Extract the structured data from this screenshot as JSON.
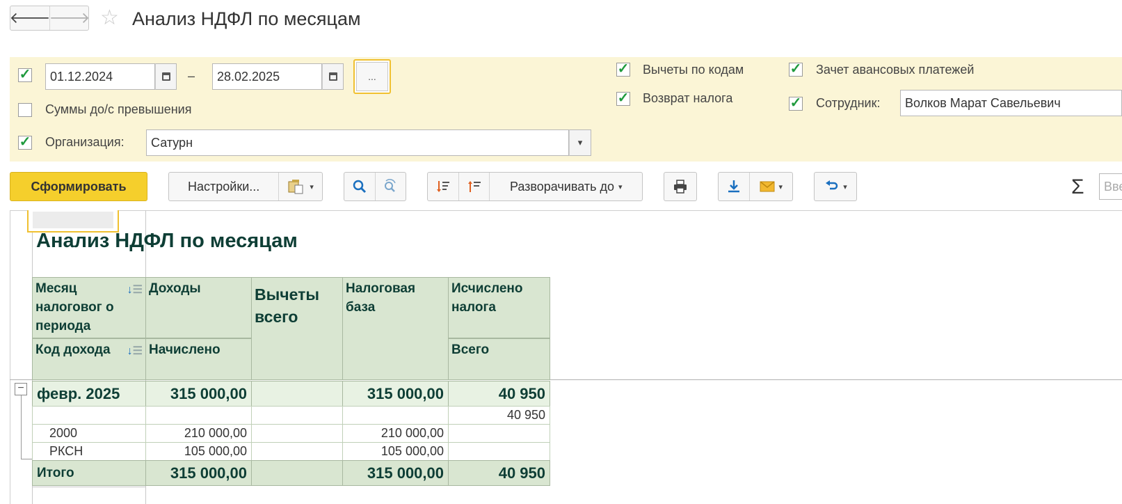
{
  "header": {
    "back_glyph": "🡐",
    "forward_glyph": "🡒",
    "star_glyph": "☆",
    "title": "Анализ НДФЛ по месяцам"
  },
  "filters": {
    "period_from": "01.12.2024",
    "period_dash": "–",
    "period_to": "28.02.2025",
    "dots_label": "...",
    "excess_label": "Суммы до/с превышения",
    "org_label": "Организация:",
    "org_value": "Сатурн",
    "deductions_codes_label": "Вычеты по кодам",
    "tax_return_label": "Возврат налога",
    "advance_label": "Зачет авансовых платежей",
    "employee_label": "Сотрудник:",
    "employee_value": "Волков Марат Савельевич",
    "dropdown_glyph": "▾"
  },
  "toolbar": {
    "generate": "Сформировать",
    "settings": "Настройки...",
    "expand_to": "Разворачивать до",
    "sigma": "Σ",
    "search_placeholder": "Вве"
  },
  "report": {
    "title": "Анализ НДФЛ по месяцам",
    "columns": {
      "month": "Месяц налоговог о периода",
      "income": "Доходы",
      "deductions": "Вычеты всего",
      "tax_base": "Налоговая база",
      "calculated": "Исчислено налога",
      "income_code": "Код дохода",
      "accrued": "Начислено",
      "total": "Всего"
    },
    "group": {
      "label": "февр. 2025",
      "income": "315 000,00",
      "deductions": "",
      "tax_base": "315 000,00",
      "calculated": "40 950"
    },
    "rows": [
      {
        "code": "",
        "income": "",
        "deductions": "",
        "tax_base": "",
        "calculated": "40 950"
      },
      {
        "code": "2000",
        "income": "210 000,00",
        "deductions": "",
        "tax_base": "210 000,00",
        "calculated": ""
      },
      {
        "code": "РКСН",
        "income": "105 000,00",
        "deductions": "",
        "tax_base": "105 000,00",
        "calculated": ""
      }
    ],
    "totals": {
      "label": "Итого",
      "income": "315 000,00",
      "deductions": "",
      "tax_base": "315 000,00",
      "calculated": "40 950"
    }
  },
  "colors": {
    "accent_yellow": "#f5cf2c",
    "panel_bg": "#fbf5d6",
    "header_green": "#d9e6d1",
    "text_dark_green": "#0e3e35",
    "check_green": "#1f9a3d"
  }
}
